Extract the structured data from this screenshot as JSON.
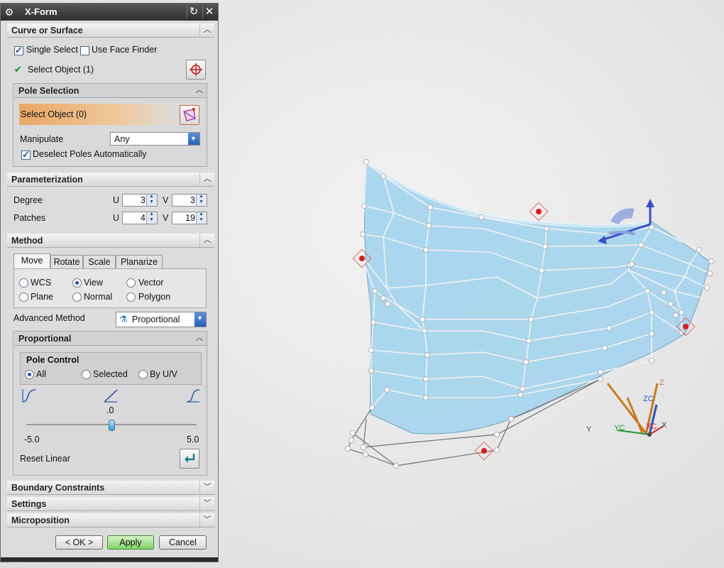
{
  "dialog": {
    "title": "X-Form",
    "close_icon": "close-icon",
    "reset_icon": "reset-icon",
    "sections": {
      "curve_or_surface": "Curve or Surface",
      "pole_selection": "Pole Selection",
      "parameterization": "Parameterization",
      "method": "Method",
      "proportional": "Proportional",
      "pole_control": "Pole Control",
      "boundary_constraints": "Boundary Constraints",
      "settings": "Settings",
      "microposition": "Microposition"
    },
    "curve": {
      "single_select": "Single Select",
      "single_select_checked": true,
      "use_face_finder": "Use Face Finder",
      "use_face_finder_checked": false,
      "select_object": "Select Object (1)"
    },
    "pole": {
      "select_object": "Select Object (0)",
      "manipulate_label": "Manipulate",
      "manipulate_value": "Any",
      "deselect": "Deselect Poles Automatically",
      "deselect_checked": true
    },
    "param": {
      "degree_label": "Degree",
      "patches_label": "Patches",
      "u": "U",
      "v": "V",
      "degree_u": "3",
      "degree_v": "3",
      "patches_u": "4",
      "patches_v": "19"
    },
    "method": {
      "tabs": [
        "Move",
        "Rotate",
        "Scale",
        "Planarize"
      ],
      "active_tab": "Move",
      "options": [
        "WCS",
        "View",
        "Vector",
        "Plane",
        "Normal",
        "Polygon"
      ],
      "selected_option": "View",
      "advanced_label": "Advanced Method",
      "advanced_value": "Proportional"
    },
    "pole_control": {
      "options": [
        "All",
        "Selected",
        "By U/V"
      ],
      "selected": "All",
      "slider_value": ".0",
      "slider_min": "-5.0",
      "slider_max": "5.0",
      "slider_fraction": 0.5,
      "reset_linear": "Reset Linear"
    },
    "buttons": {
      "ok": "< OK >",
      "apply": "Apply",
      "cancel": "Cancel"
    }
  },
  "graphics": {
    "triad_labels": [
      "ZC",
      "YC",
      "XC",
      "Z",
      "Y",
      "X"
    ],
    "surface_color": "#a8d6ee"
  }
}
